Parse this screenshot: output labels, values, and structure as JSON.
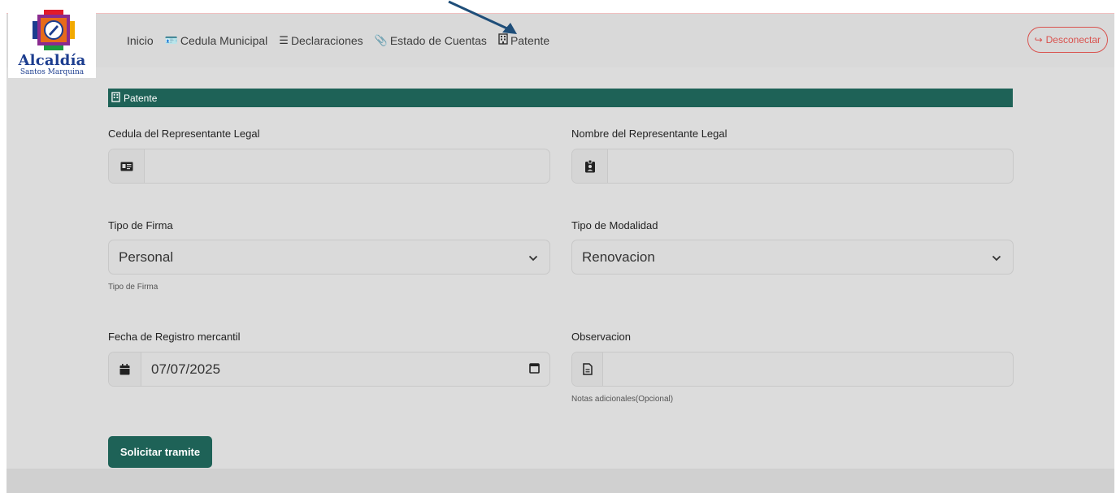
{
  "brand": {
    "title": "Alcaldía",
    "subtitle": "Santos Marquina"
  },
  "nav": {
    "items": [
      {
        "label": "Inicio",
        "icon": ""
      },
      {
        "label": "Cedula Municipal",
        "icon": "id-card-icon"
      },
      {
        "label": "Declaraciones",
        "icon": "list-icon"
      },
      {
        "label": "Estado de Cuentas",
        "icon": "paperclip-icon"
      },
      {
        "label": "Patente",
        "icon": "building-icon"
      }
    ],
    "logout_label": "Desconectar"
  },
  "section": {
    "title": "Patente"
  },
  "form": {
    "cedula": {
      "label": "Cedula del Representante Legal",
      "value": ""
    },
    "nombre": {
      "label": "Nombre del Representante Legal",
      "value": ""
    },
    "tipo_firma": {
      "label": "Tipo de Firma",
      "selected": "Personal",
      "help": "Tipo de Firma"
    },
    "tipo_modalidad": {
      "label": "Tipo de Modalidad",
      "selected": "Renovacion"
    },
    "fecha": {
      "label": "Fecha de Registro mercantil",
      "value": "07/07/2025"
    },
    "observacion": {
      "label": "Observacion",
      "value": "",
      "help": "Notas adicionales(Opcional)"
    },
    "submit_label": "Solicitar tramite"
  },
  "colors": {
    "primary": "#1e6257",
    "danger": "#d9534f",
    "background": "#dcdcdc"
  }
}
